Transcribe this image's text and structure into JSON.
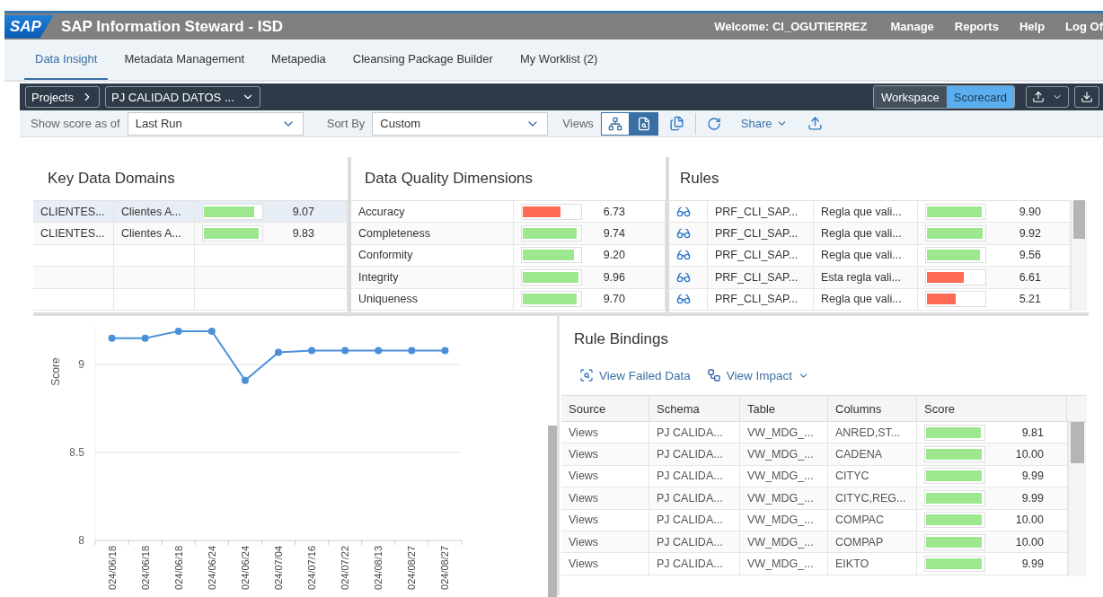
{
  "header": {
    "logo": "SAP",
    "title": "SAP Information Steward - ISD",
    "welcome": "Welcome: CI_OGUTIERREZ",
    "links": [
      "Manage",
      "Reports",
      "Help",
      "Log Of"
    ]
  },
  "tabs": [
    {
      "label": "Data Insight",
      "selected": true
    },
    {
      "label": "Metadata Management",
      "selected": false
    },
    {
      "label": "Metapedia",
      "selected": false
    },
    {
      "label": "Cleansing Package Builder",
      "selected": false
    },
    {
      "label": "My Worklist (2)",
      "selected": false
    }
  ],
  "toolbar": {
    "breadcrumb": "Projects",
    "project": "PJ CALIDAD DATOS ...",
    "modes": [
      {
        "label": "Workspace",
        "selected": false
      },
      {
        "label": "Scorecard",
        "selected": true
      }
    ]
  },
  "filter_bar": {
    "score_label": "Show score as of",
    "score_value": "Last Run",
    "sort_label": "Sort By",
    "sort_value": "Custom",
    "views_label": "Views",
    "views": [
      {
        "kind": "tree",
        "selected": false
      },
      {
        "kind": "report",
        "selected": true
      }
    ],
    "share": "Share"
  },
  "key_data_domains": {
    "title": "Key Data Domains",
    "rows": [
      {
        "domain": "CLIENTES...",
        "name": "Clientes A...",
        "level": 0.907,
        "color": "#9de88f",
        "score": "9.07",
        "selected": true
      },
      {
        "domain": "CLIENTES...",
        "name": "Clientes A...",
        "level": 0.983,
        "color": "#9de88f",
        "score": "9.83",
        "selected": false
      }
    ]
  },
  "dimensions": {
    "title": "Data Quality Dimensions",
    "rows": [
      {
        "name": "Accuracy",
        "level": 0.673,
        "color": "#ff6a55",
        "score": "6.73"
      },
      {
        "name": "Completeness",
        "level": 0.974,
        "color": "#9de88f",
        "score": "9.74"
      },
      {
        "name": "Conformity",
        "level": 0.92,
        "color": "#9de88f",
        "score": "9.20"
      },
      {
        "name": "Integrity",
        "level": 0.996,
        "color": "#9de88f",
        "score": "9.96"
      },
      {
        "name": "Uniqueness",
        "level": 0.97,
        "color": "#9de88f",
        "score": "9.70"
      }
    ]
  },
  "rules": {
    "title": "Rules",
    "rows": [
      {
        "name": "PRF_CLI_SAP...",
        "description": "Regla que vali...",
        "level": 0.99,
        "color": "#9de88f",
        "score": "9.90"
      },
      {
        "name": "PRF_CLI_SAP...",
        "description": "Regla que vali...",
        "level": 0.992,
        "color": "#9de88f",
        "score": "9.92"
      },
      {
        "name": "PRF_CLI_SAP...",
        "description": "Regla que vali...",
        "level": 0.956,
        "color": "#9de88f",
        "score": "9.56"
      },
      {
        "name": "PRF_CLI_SAP...",
        "description": "Esta regla vali...",
        "level": 0.661,
        "color": "#ff6a55",
        "score": "6.61"
      },
      {
        "name": "PRF_CLI_SAP...",
        "description": "Regla que vali...",
        "level": 0.521,
        "color": "#ff6a55",
        "score": "5.21"
      }
    ]
  },
  "trend": {
    "chart_data": {
      "type": "line",
      "ylabel": "Score",
      "categories": [
        "024/06/18",
        "024/06/18",
        "024/06/18",
        "024/06/24",
        "024/06/24",
        "024/07/04",
        "024/07/16",
        "024/07/22",
        "024/08/13",
        "024/08/27",
        "024/08/27"
      ],
      "series": [
        {
          "color": "#4a90d9",
          "marker": "circle",
          "values": [
            9.15,
            9.15,
            9.19,
            9.19,
            8.91,
            9.07,
            9.08,
            9.08,
            9.08,
            9.08,
            9.08
          ]
        }
      ],
      "ylim": [
        8,
        9.22
      ],
      "yticks": [
        8,
        {
          "value": 8.5,
          "label": "8.5"
        },
        9
      ]
    }
  },
  "rule_bindings": {
    "title": "Rule Bindings",
    "actions": [
      {
        "kind": "failed",
        "label": "View Failed Data"
      },
      {
        "kind": "impact",
        "label": "View Impact"
      }
    ],
    "columns": [
      "Source",
      "Schema",
      "Table",
      "Columns",
      "Score"
    ],
    "rows": [
      {
        "source": "Views",
        "schema": "PJ CALIDA...",
        "table": "VW_MDG_...",
        "columns": "ANRED,ST...",
        "level": 0.981,
        "color": "#9de88f",
        "score": "9.81"
      },
      {
        "source": "Views",
        "schema": "PJ CALIDA...",
        "table": "VW_MDG_...",
        "columns": "CADENA",
        "level": 1,
        "color": "#9de88f",
        "score": "10.00"
      },
      {
        "source": "Views",
        "schema": "PJ CALIDA...",
        "table": "VW_MDG_...",
        "columns": "CITYC",
        "level": 0.999,
        "color": "#9de88f",
        "score": "9.99"
      },
      {
        "source": "Views",
        "schema": "PJ CALIDA...",
        "table": "VW_MDG_...",
        "columns": "CITYC,REG...",
        "level": 0.999,
        "color": "#9de88f",
        "score": "9.99"
      },
      {
        "source": "Views",
        "schema": "PJ CALIDA...",
        "table": "VW_MDG_...",
        "columns": "COMPAC",
        "level": 1,
        "color": "#9de88f",
        "score": "10.00"
      },
      {
        "source": "Views",
        "schema": "PJ CALIDA...",
        "table": "VW_MDG_...",
        "columns": "COMPAP",
        "level": 1,
        "color": "#9de88f",
        "score": "10.00"
      },
      {
        "source": "Views",
        "schema": "PJ CALIDA...",
        "table": "VW_MDG_...",
        "columns": "EIKTO",
        "level": 0.999,
        "color": "#9de88f",
        "score": "9.99"
      }
    ]
  }
}
